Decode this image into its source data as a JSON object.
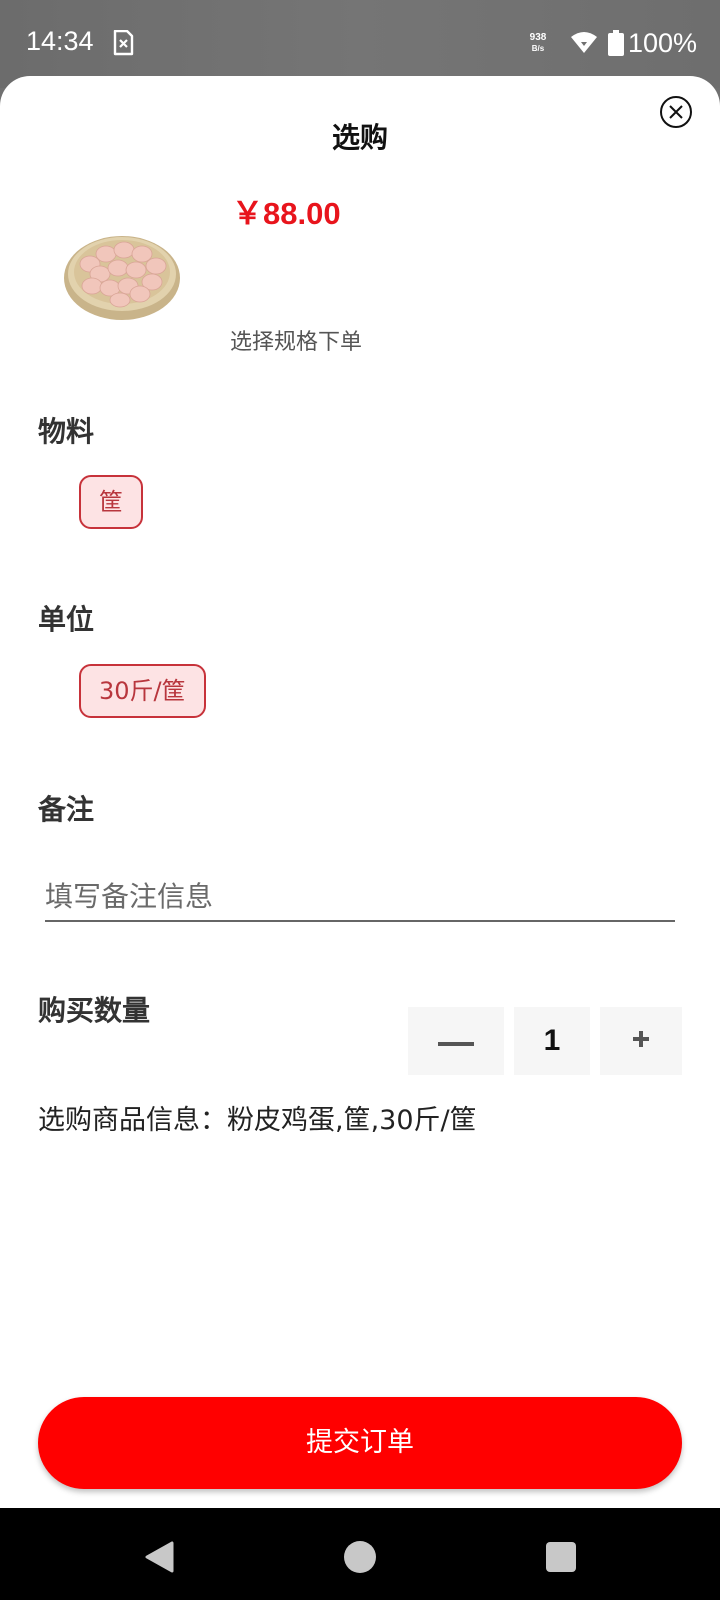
{
  "status_bar": {
    "time": "14:34",
    "net_speed_value": "938",
    "net_speed_unit": "B/s",
    "battery": "100%",
    "icons": [
      "sim-card-icon",
      "wifi-icon",
      "battery-icon"
    ]
  },
  "sheet": {
    "title": "选购",
    "close_icon": "close-circle-icon"
  },
  "product": {
    "price": "￥88.00",
    "hint": "选择规格下单",
    "image": "egg-basket-image"
  },
  "material": {
    "label": "物料",
    "options": [
      "筐"
    ],
    "selected": "筐"
  },
  "unit": {
    "label": "单位",
    "options": [
      "30斤/筐"
    ],
    "selected": "30斤/筐"
  },
  "remark": {
    "label": "备注",
    "placeholder": "填写备注信息",
    "value": ""
  },
  "quantity": {
    "label": "购买数量",
    "value": "1",
    "decrease_icon": "minus-icon",
    "increase_icon": "plus-icon"
  },
  "order_info": "选购商品信息：粉皮鸡蛋,筐,30斤/筐",
  "submit": {
    "label": "提交订单"
  },
  "colors": {
    "accent": "#ff0000",
    "price": "#e8141c",
    "chip_border": "#c7323a",
    "chip_bg": "#fde3e4"
  }
}
